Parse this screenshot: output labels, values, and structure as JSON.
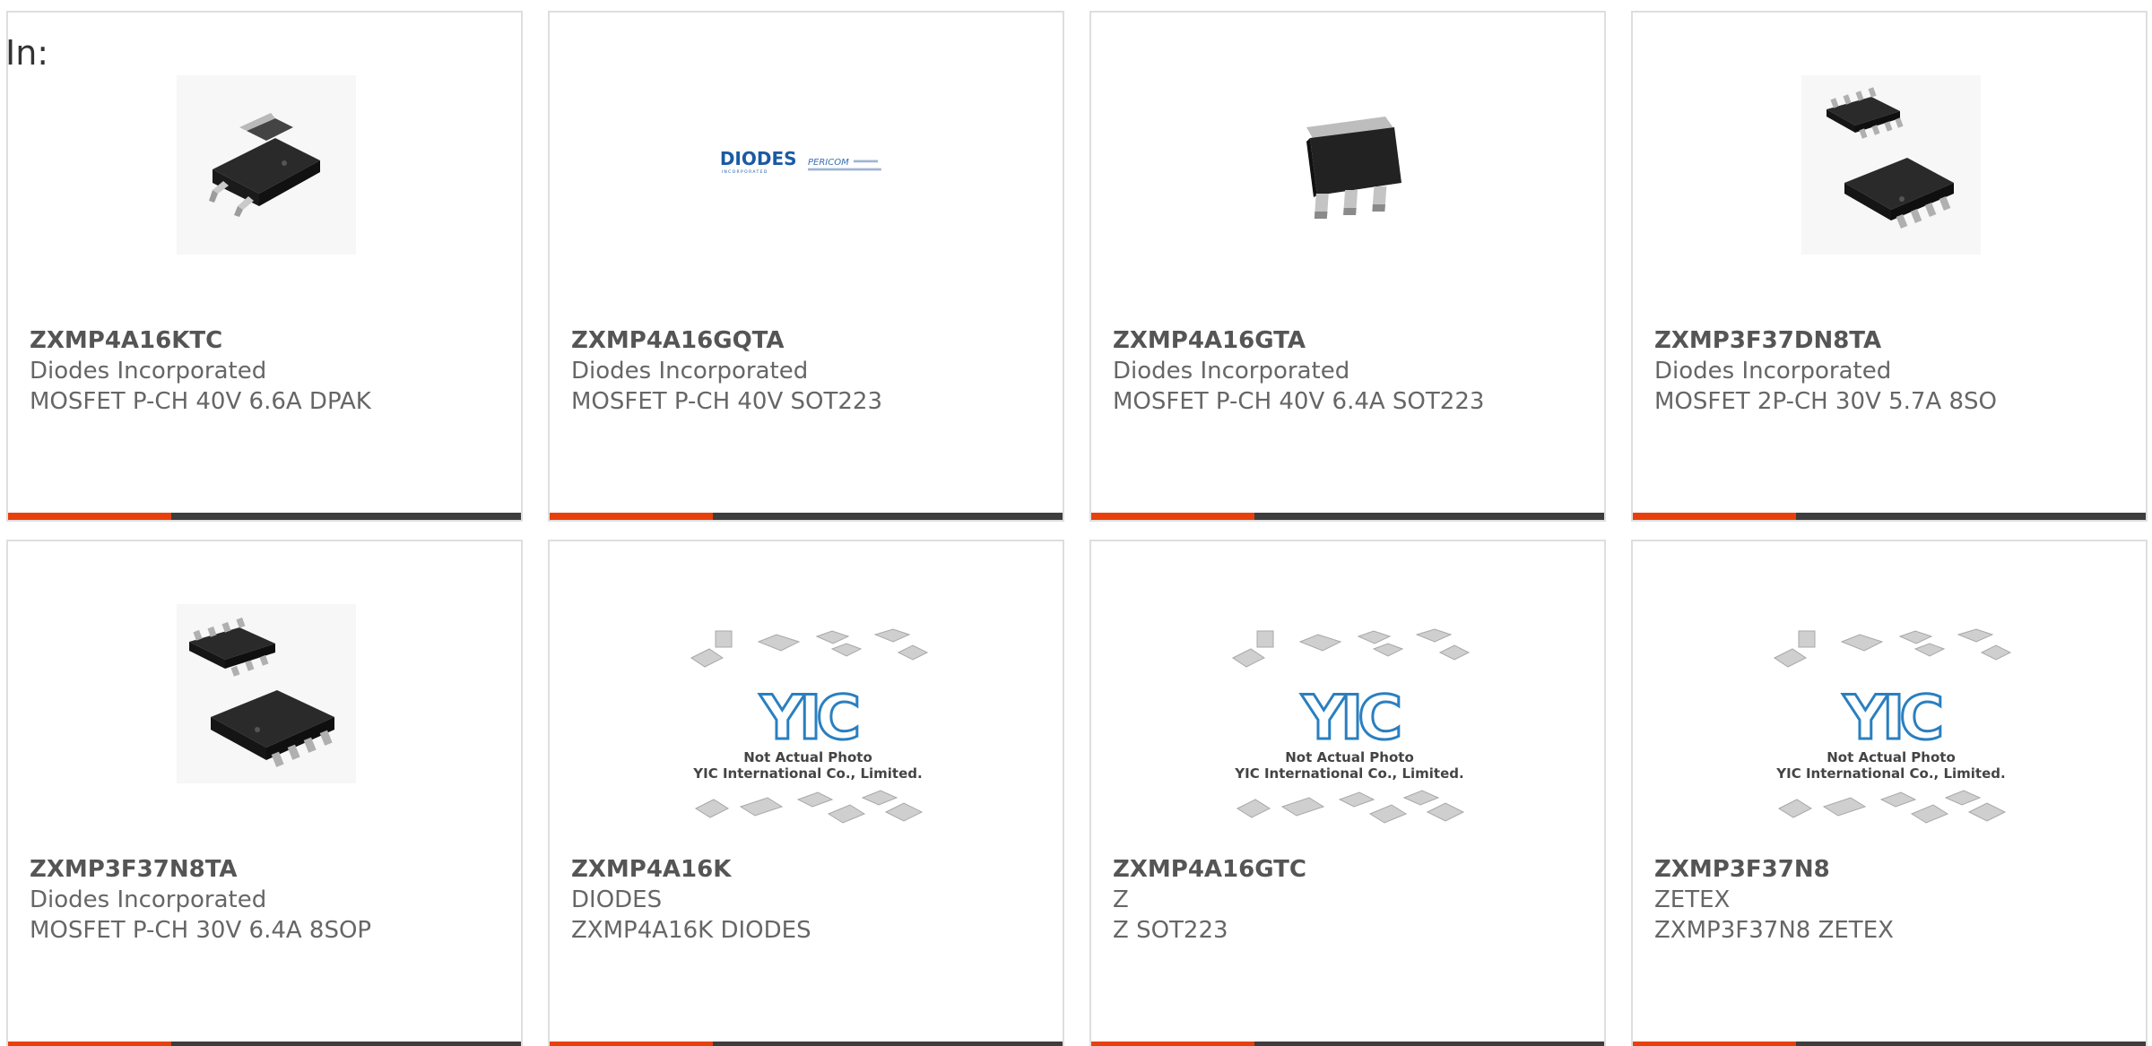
{
  "filter": {
    "label": "In:"
  },
  "colors": {
    "accent": "#e8400c",
    "bar": "#3d3d3d",
    "border": "#dedede"
  },
  "products": [
    {
      "part_number": "ZXMP4A16KTC",
      "manufacturer": "Diodes Incorporated",
      "description": "MOSFET P-CH 40V 6.6A DPAK",
      "image": "dpak-package-icon"
    },
    {
      "part_number": "ZXMP4A16GQTA",
      "manufacturer": "Diodes Incorporated",
      "description": "MOSFET P-CH 40V SOT223",
      "image": "diodes-logo",
      "logo": {
        "brand": "DIODES",
        "tagline": "INCORPORATED",
        "sub_brand": "PERICOM"
      }
    },
    {
      "part_number": "ZXMP4A16GTA",
      "manufacturer": "Diodes Incorporated",
      "description": "MOSFET P-CH 40V 6.4A SOT223",
      "image": "sot223-package-icon"
    },
    {
      "part_number": "ZXMP3F37DN8TA",
      "manufacturer": "Diodes Incorporated",
      "description": "MOSFET 2P-CH 30V 5.7A 8SO",
      "image": "so8-package-icon"
    },
    {
      "part_number": "ZXMP3F37N8TA",
      "manufacturer": "Diodes Incorporated",
      "description": "MOSFET P-CH 30V 6.4A 8SOP",
      "image": "so8-package-icon"
    },
    {
      "part_number": "ZXMP4A16K",
      "manufacturer": "DIODES",
      "description": "ZXMP4A16K DIODES",
      "image": "placeholder-photo",
      "placeholder": {
        "logo": "YIC",
        "line1": "Not Actual Photo",
        "line2": "YIC International Co., Limited."
      }
    },
    {
      "part_number": "ZXMP4A16GTC",
      "manufacturer": "Z",
      "description": "Z SOT223",
      "image": "placeholder-photo",
      "placeholder": {
        "logo": "YIC",
        "line1": "Not Actual Photo",
        "line2": "YIC International Co., Limited."
      }
    },
    {
      "part_number": "ZXMP3F37N8",
      "manufacturer": "ZETEX",
      "description": "ZXMP3F37N8 ZETEX",
      "image": "placeholder-photo",
      "placeholder": {
        "logo": "YIC",
        "line1": "Not Actual Photo",
        "line2": "YIC International Co., Limited."
      }
    }
  ]
}
